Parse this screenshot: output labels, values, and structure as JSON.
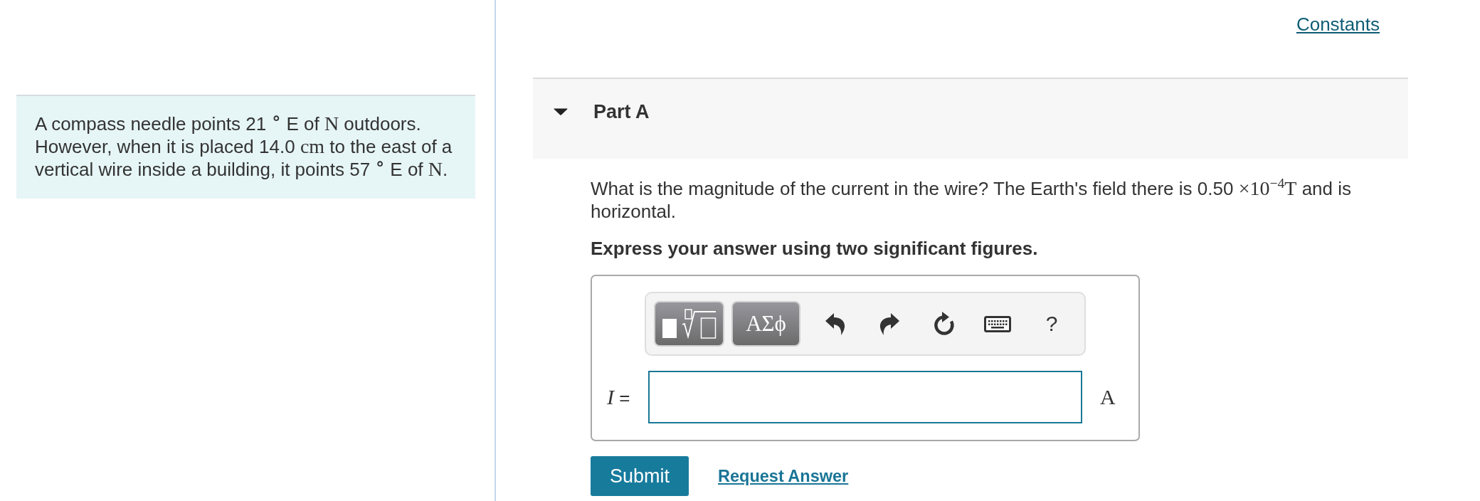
{
  "problem": {
    "segments": [
      {
        "kind": "text",
        "text": "A compass needle points 21 "
      },
      {
        "kind": "math",
        "text": "$^{∘}$"
      },
      {
        "kind": "text",
        "text": " E of "
      },
      {
        "kind": "math",
        "text": "N"
      },
      {
        "kind": "text",
        "text": " outdoors. However, when it is placed 14.0 "
      },
      {
        "kind": "math",
        "text": "cm"
      },
      {
        "kind": "text",
        "text": " to the east of a vertical wire inside a building, it points 57 "
      },
      {
        "kind": "math",
        "text": "$^{∘}$"
      },
      {
        "kind": "text",
        "text": " E of "
      },
      {
        "kind": "math",
        "text": "N"
      },
      {
        "kind": "text",
        "text": "."
      }
    ]
  },
  "constants_link": "Constants",
  "part": {
    "title": "Part A",
    "expanded": true,
    "question": {
      "segments": [
        {
          "kind": "text",
          "text": "What is the magnitude of the current in the wire? The Earth's field there is 0.50 "
        },
        {
          "kind": "math",
          "text": "×10$^{−4}$T"
        },
        {
          "kind": "text",
          "text": " and is horizontal."
        }
      ]
    },
    "instruction": "Express your answer using two significant figures.",
    "answer": {
      "toolbar": [
        {
          "kind": "templates"
        },
        {
          "kind": "symbols",
          "label": "ΑΣϕ"
        },
        {
          "kind": "undo"
        },
        {
          "kind": "redo"
        },
        {
          "kind": "reset"
        },
        {
          "kind": "keyboard"
        },
        {
          "kind": "help",
          "label": "?"
        }
      ],
      "variable": "*I* =",
      "unit": "A"
    },
    "actions": {
      "submit": "Submit",
      "request": "Request Answer"
    }
  }
}
